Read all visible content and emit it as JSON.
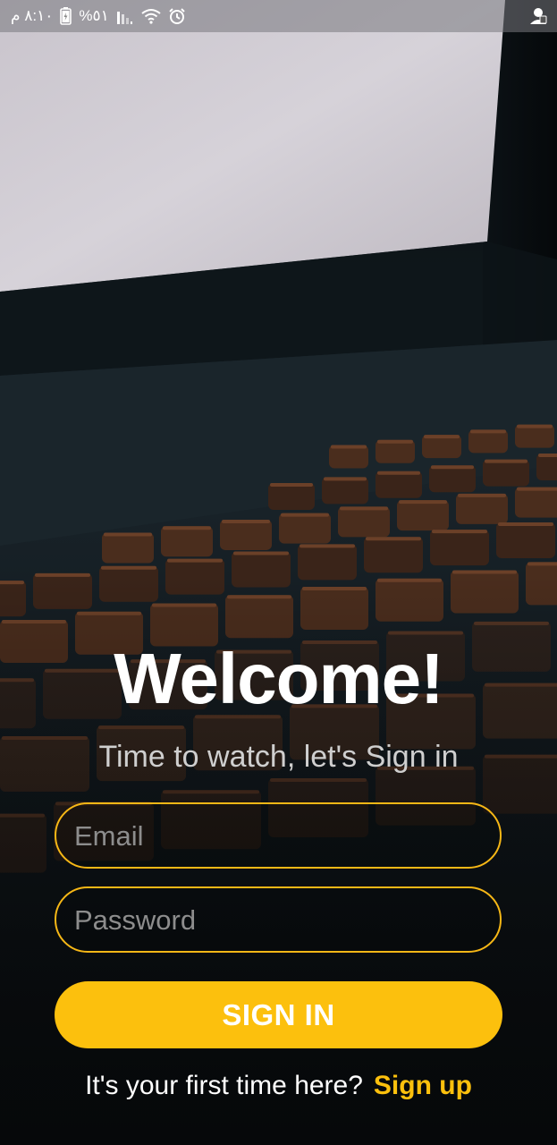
{
  "status_bar": {
    "time": "٨:١٠ م",
    "battery": "%٥١",
    "icons": [
      "battery-icon",
      "signal-icon",
      "wifi-icon",
      "alarm-icon",
      "profile-icon"
    ]
  },
  "background": {
    "description_icon": "cinema-theater-image"
  },
  "welcome": {
    "title": "Welcome!",
    "subtitle": "Time to watch, let's Sign in"
  },
  "form": {
    "email_placeholder": "Email",
    "email_value": "",
    "password_placeholder": "Password",
    "password_value": "",
    "submit_label": "SIGN IN"
  },
  "signup": {
    "prompt": "It's your first time here?",
    "link_label": "Sign up"
  },
  "colors": {
    "accent": "#fcc00d",
    "field_border": "#f6b716",
    "background": "#0b0f12"
  }
}
